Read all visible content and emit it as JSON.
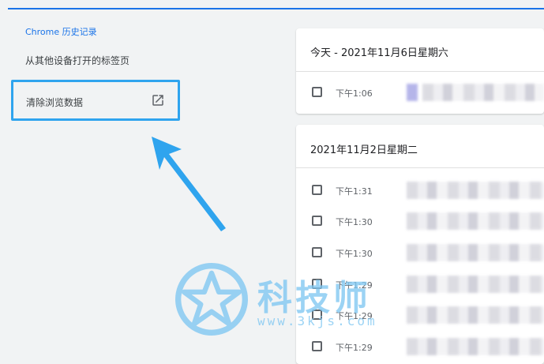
{
  "sidebar": {
    "title": "Chrome 历史记录",
    "other_devices": "从其他设备打开的标签页",
    "clear_data": "清除浏览数据"
  },
  "cards": [
    {
      "date": "今天 - 2021年11月6日星期六",
      "rows": [
        {
          "time": "下午1:06"
        }
      ]
    },
    {
      "date": "2021年11月2日星期二",
      "rows": [
        {
          "time": "下午1:31"
        },
        {
          "time": "下午1:30"
        },
        {
          "time": "下午1:30"
        },
        {
          "time": "下午1:29"
        },
        {
          "time": "下午1:29"
        },
        {
          "time": "下午1:29"
        }
      ]
    }
  ],
  "watermark": {
    "name": "科技师",
    "url": "www.3kjs.com"
  },
  "colors": {
    "accent": "#1a73e8",
    "highlight": "#2fa4ee",
    "watermark": "#7fc7f2"
  },
  "icons": {
    "external_link": "external-link-icon",
    "arrow": "arrow-annotation"
  }
}
